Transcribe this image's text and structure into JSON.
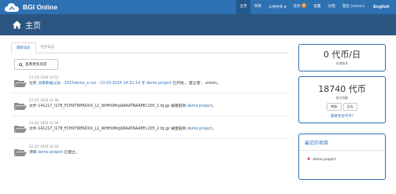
{
  "app": {
    "brand": "BGI Online"
  },
  "topnav": {
    "items": [
      "主页",
      "项目",
      "公共共享",
      "任务",
      "设置",
      "文档",
      "登出 (simon)",
      "English"
    ],
    "share_caret": "▼",
    "task_badge": "0"
  },
  "header": {
    "title": "主页"
  },
  "tabs": [
    "最新动态",
    "任务日志"
  ],
  "more_button": "查看更多动态",
  "feed": [
    {
      "time": "23 2月 2016 14:52",
      "p1": "任务 ",
      "link1": "消毒数据过滤 - 2015demo_a run - 23-02-2016 14:51:14",
      "p2": " 于 ",
      "link2": "demo project",
      "p3": " 已开始 。建立者： simon。"
    },
    {
      "time": "23 2月 2016 14:38",
      "p1": "文件 141217_I178_FCH9TWFADXX_L1_WHHUMrpbRAATRAAPEI-205_1.fq.gz 被建链到 ",
      "link1": "demo project",
      "p2": "。"
    },
    {
      "time": "23 2月 2016 14:36",
      "p1": "文件 141217_I178_FCH9TWFADXX_L1_WHHUMrpbRAATRAAPEI-205_2.fq.gz 被建链到 ",
      "link1": "demo project",
      "p2": "。"
    },
    {
      "time": "23 2月 2016 14:36",
      "p1": "项目 ",
      "link1": "demo project",
      "p2": " 已建立。"
    }
  ],
  "cost_panel": {
    "value": "0 代币/日",
    "label": "存储成本"
  },
  "balance_panel": {
    "value": "18740 代币",
    "label": "既往余额",
    "transfer": "转账",
    "log": "日志",
    "link": "需要更多代币?"
  },
  "recent_panel": {
    "title": "最近的项目",
    "projects": [
      "demo project"
    ]
  },
  "colors": {
    "topbar": "#2e71b3",
    "subheader": "#2a5681",
    "link": "#2e71b3",
    "badge": "#ea8a2c"
  }
}
